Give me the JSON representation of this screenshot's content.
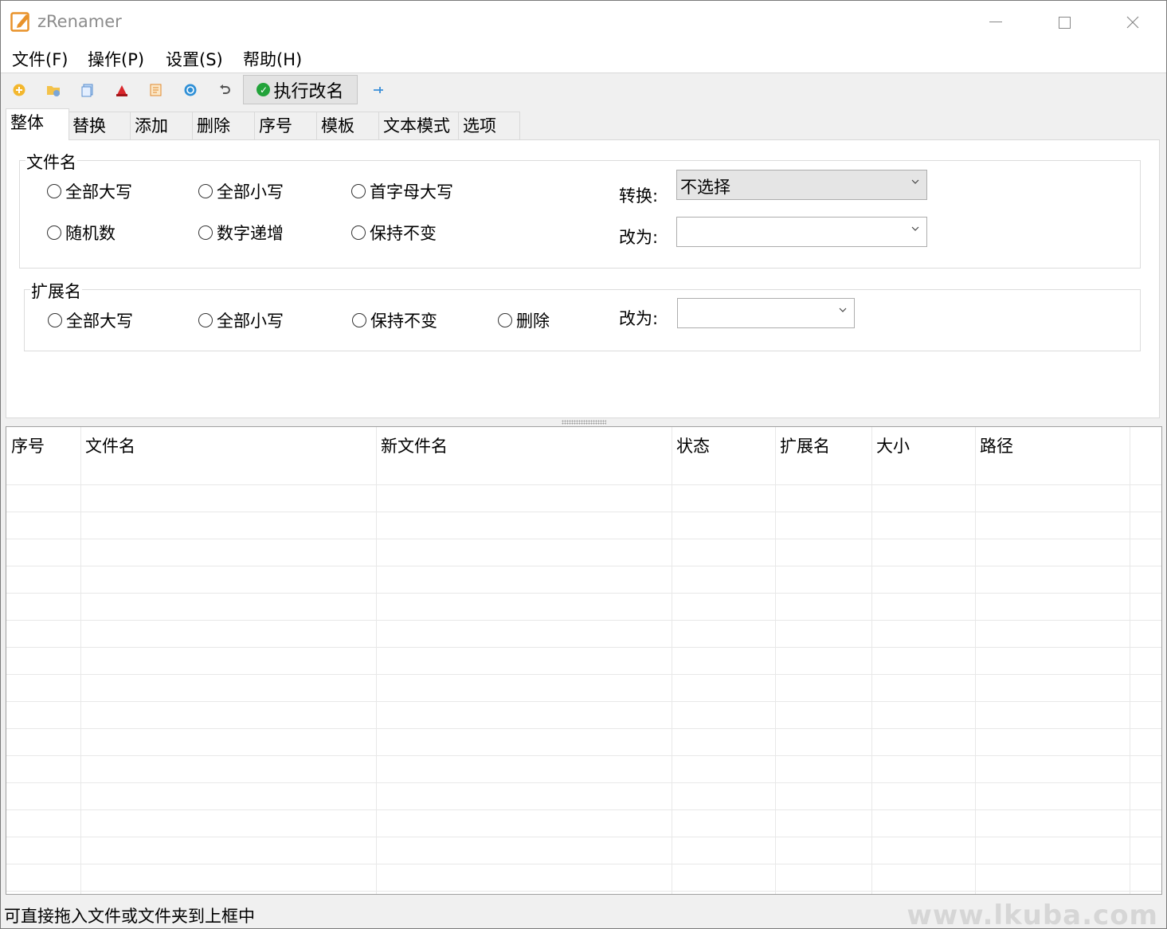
{
  "window": {
    "title": "zRenamer"
  },
  "menu": [
    "文件(F)",
    "操作(P)",
    "设置(S)",
    "帮助(H)"
  ],
  "toolbar": {
    "icons": [
      "add-file-icon",
      "add-folder-icon",
      "copy-list-icon",
      "clear-icon",
      "edit-list-icon",
      "refresh-icon",
      "undo-icon"
    ],
    "execute_label": "执行改名",
    "pin_icon": "pin-icon"
  },
  "tabs": [
    "整体",
    "替换",
    "添加",
    "删除",
    "序号",
    "模板",
    "文本模式",
    "选项"
  ],
  "filename_group": {
    "title": "文件名",
    "options": [
      "全部大写",
      "全部小写",
      "首字母大写",
      "随机数",
      "数字递增",
      "保持不变"
    ],
    "convert_label": "转换:",
    "convert_value": "不选择",
    "change_to_label": "改为:",
    "change_to_value": ""
  },
  "extension_group": {
    "title": "扩展名",
    "options": [
      "全部大写",
      "全部小写",
      "保持不变",
      "删除"
    ],
    "change_to_label": "改为:",
    "change_to_value": ""
  },
  "file_list": {
    "columns": [
      "序号",
      "文件名",
      "新文件名",
      "状态",
      "扩展名",
      "大小",
      "路径"
    ],
    "rows": []
  },
  "status": {
    "text": "可直接拖入文件或文件夹到上框中"
  },
  "watermark": "www.lkuba.com",
  "colors": {
    "execute_check": "#22a33a",
    "app_icon": "#e8922a"
  }
}
